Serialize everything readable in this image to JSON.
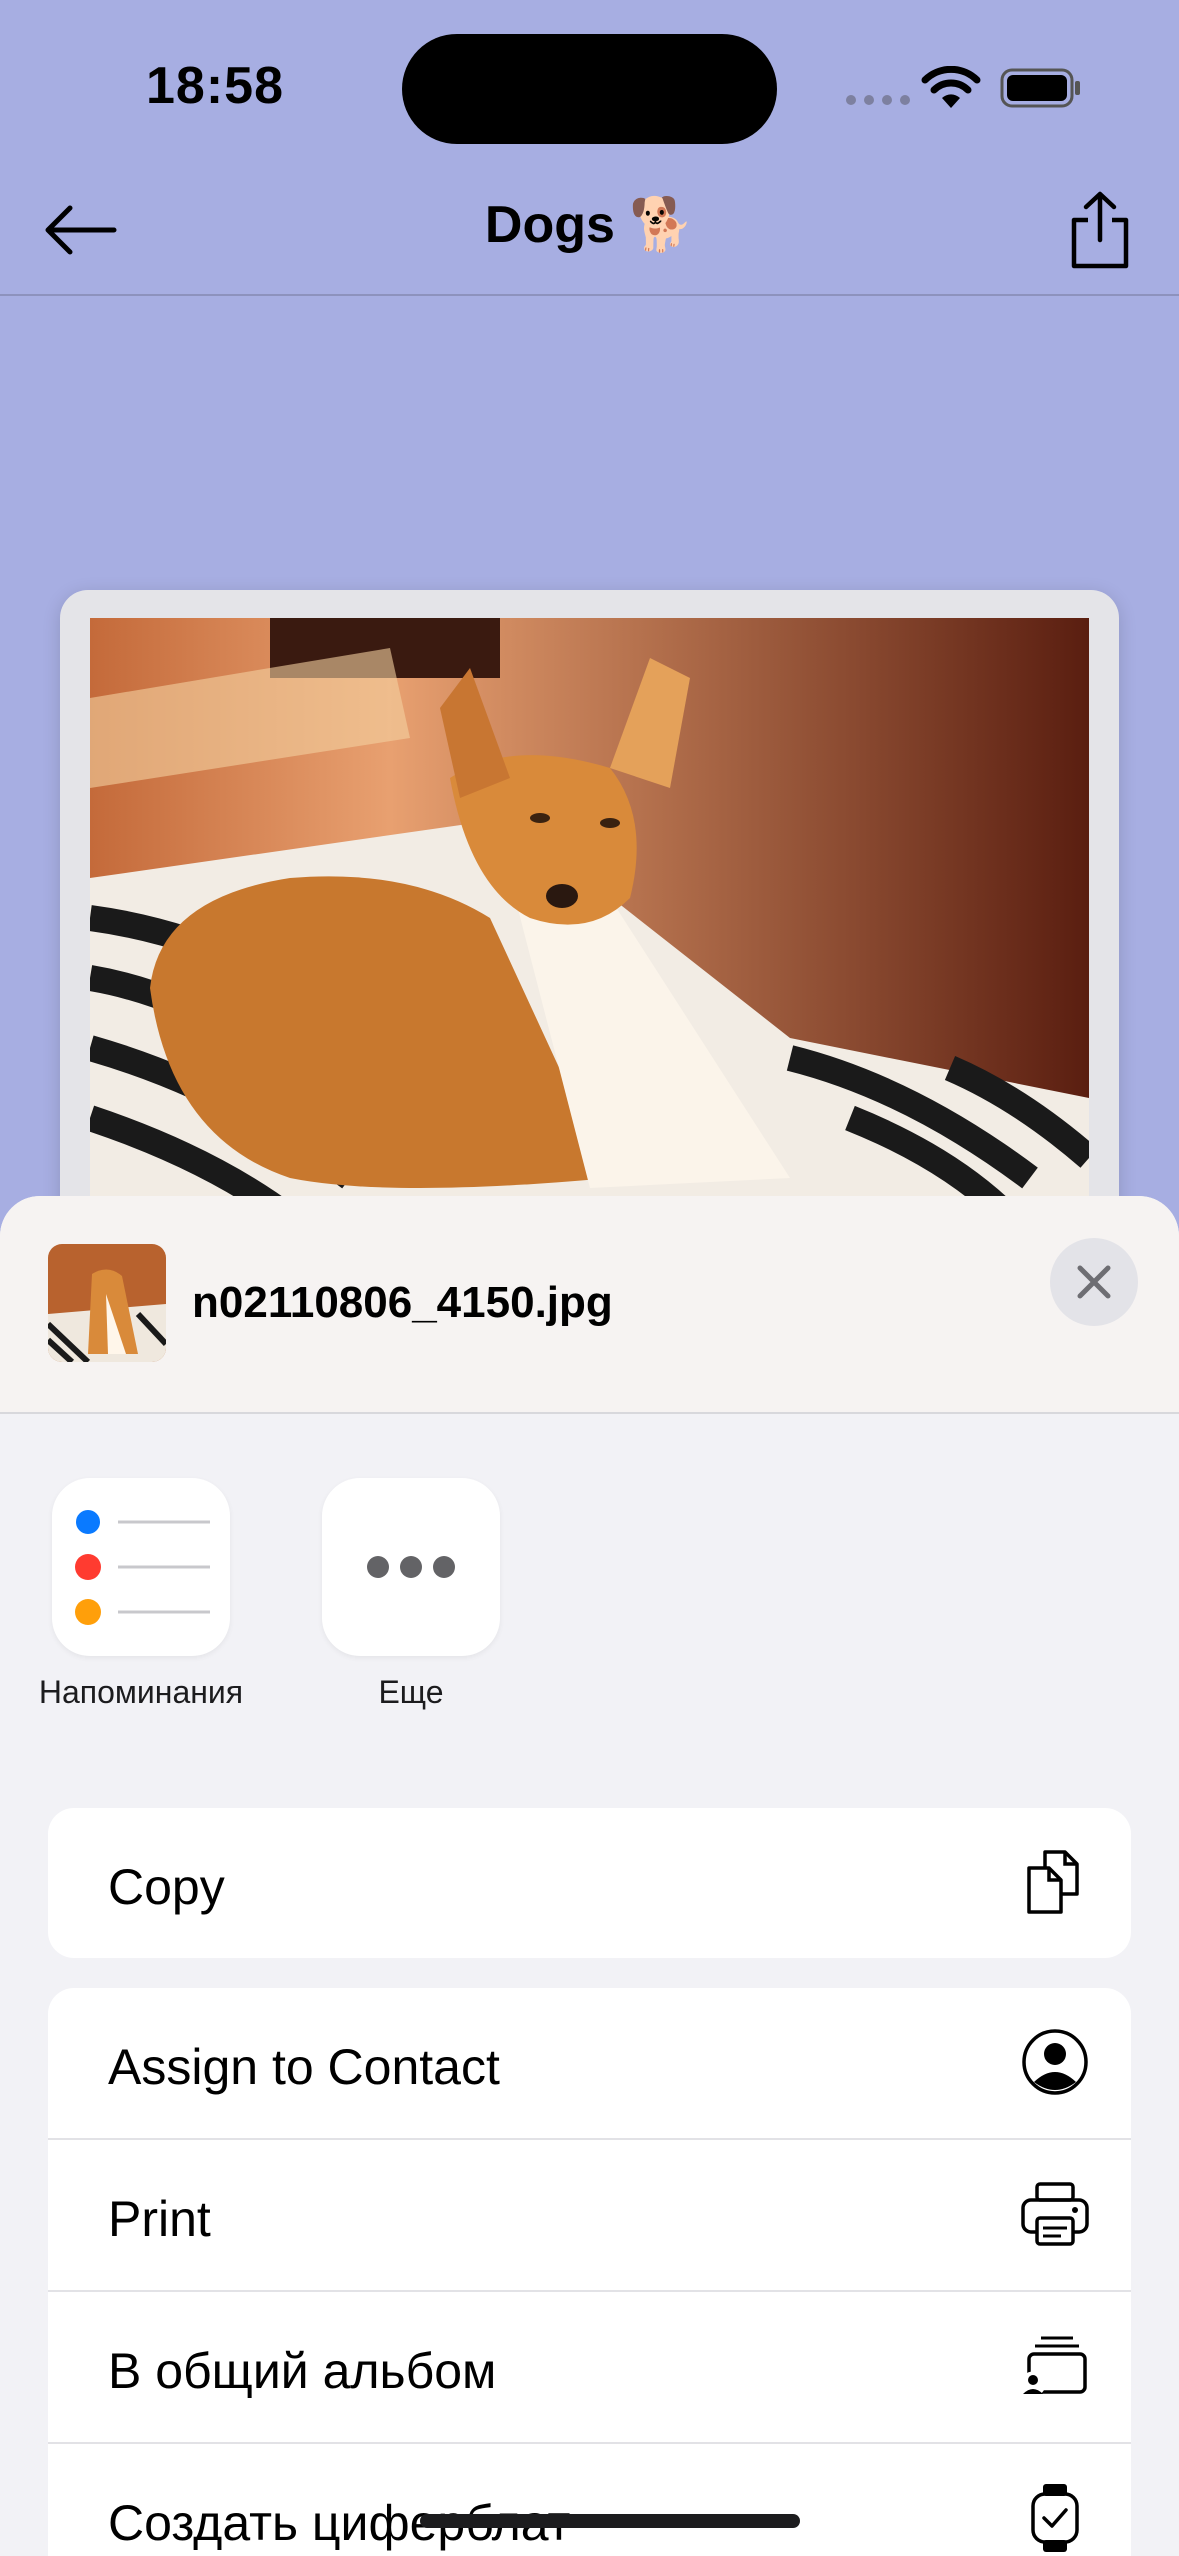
{
  "status_bar": {
    "time": "18:58"
  },
  "nav": {
    "title": "Dogs 🐕"
  },
  "share_sheet": {
    "filename": "n02110806_4150.jpg",
    "apps": [
      {
        "label": "Напоминания",
        "icon": "reminders-icon"
      },
      {
        "label": "Еще",
        "icon": "more-icon"
      }
    ],
    "actions_group1": [
      {
        "label": "Copy",
        "icon": "copy-icon"
      }
    ],
    "actions_group2": [
      {
        "label": "Assign to Contact",
        "icon": "contact-icon"
      },
      {
        "label": "Print",
        "icon": "printer-icon"
      },
      {
        "label": "В общий альбом",
        "icon": "shared-album-icon"
      },
      {
        "label": "Создать циферблат",
        "icon": "watch-icon"
      }
    ]
  },
  "colors": {
    "background": "#a7aee2",
    "sheet": "#f2f2f6",
    "reminder_blue": "#0a7aff",
    "reminder_red": "#ff3b30",
    "reminder_orange": "#ff9f0a"
  }
}
